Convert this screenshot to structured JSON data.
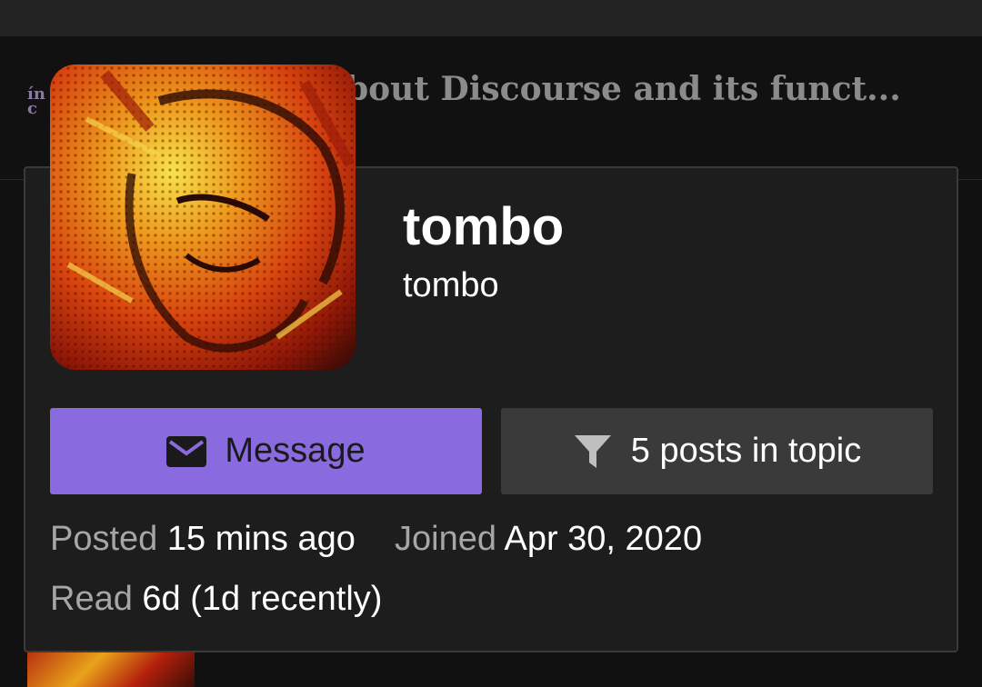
{
  "header": {
    "logo_lines": [
      "ín",
      "c"
    ],
    "topic_title": "bout Discourse and its funct..."
  },
  "user_card": {
    "display_name": "tombo",
    "username": "tombo",
    "buttons": {
      "message_label": "Message",
      "filter_label": "5 posts in topic"
    },
    "meta": {
      "posted_label": "Posted",
      "posted_value": "15 mins ago",
      "joined_label": "Joined",
      "joined_value": "Apr 30, 2020",
      "read_label": "Read",
      "read_value": "6d (1d recently)"
    }
  },
  "colors": {
    "accent": "#8a6bdf",
    "card_bg": "#1d1d1d",
    "page_bg": "#111111",
    "secondary_button": "#3a3a3a"
  },
  "icons": {
    "message": "envelope-icon",
    "filter": "filter-icon"
  }
}
